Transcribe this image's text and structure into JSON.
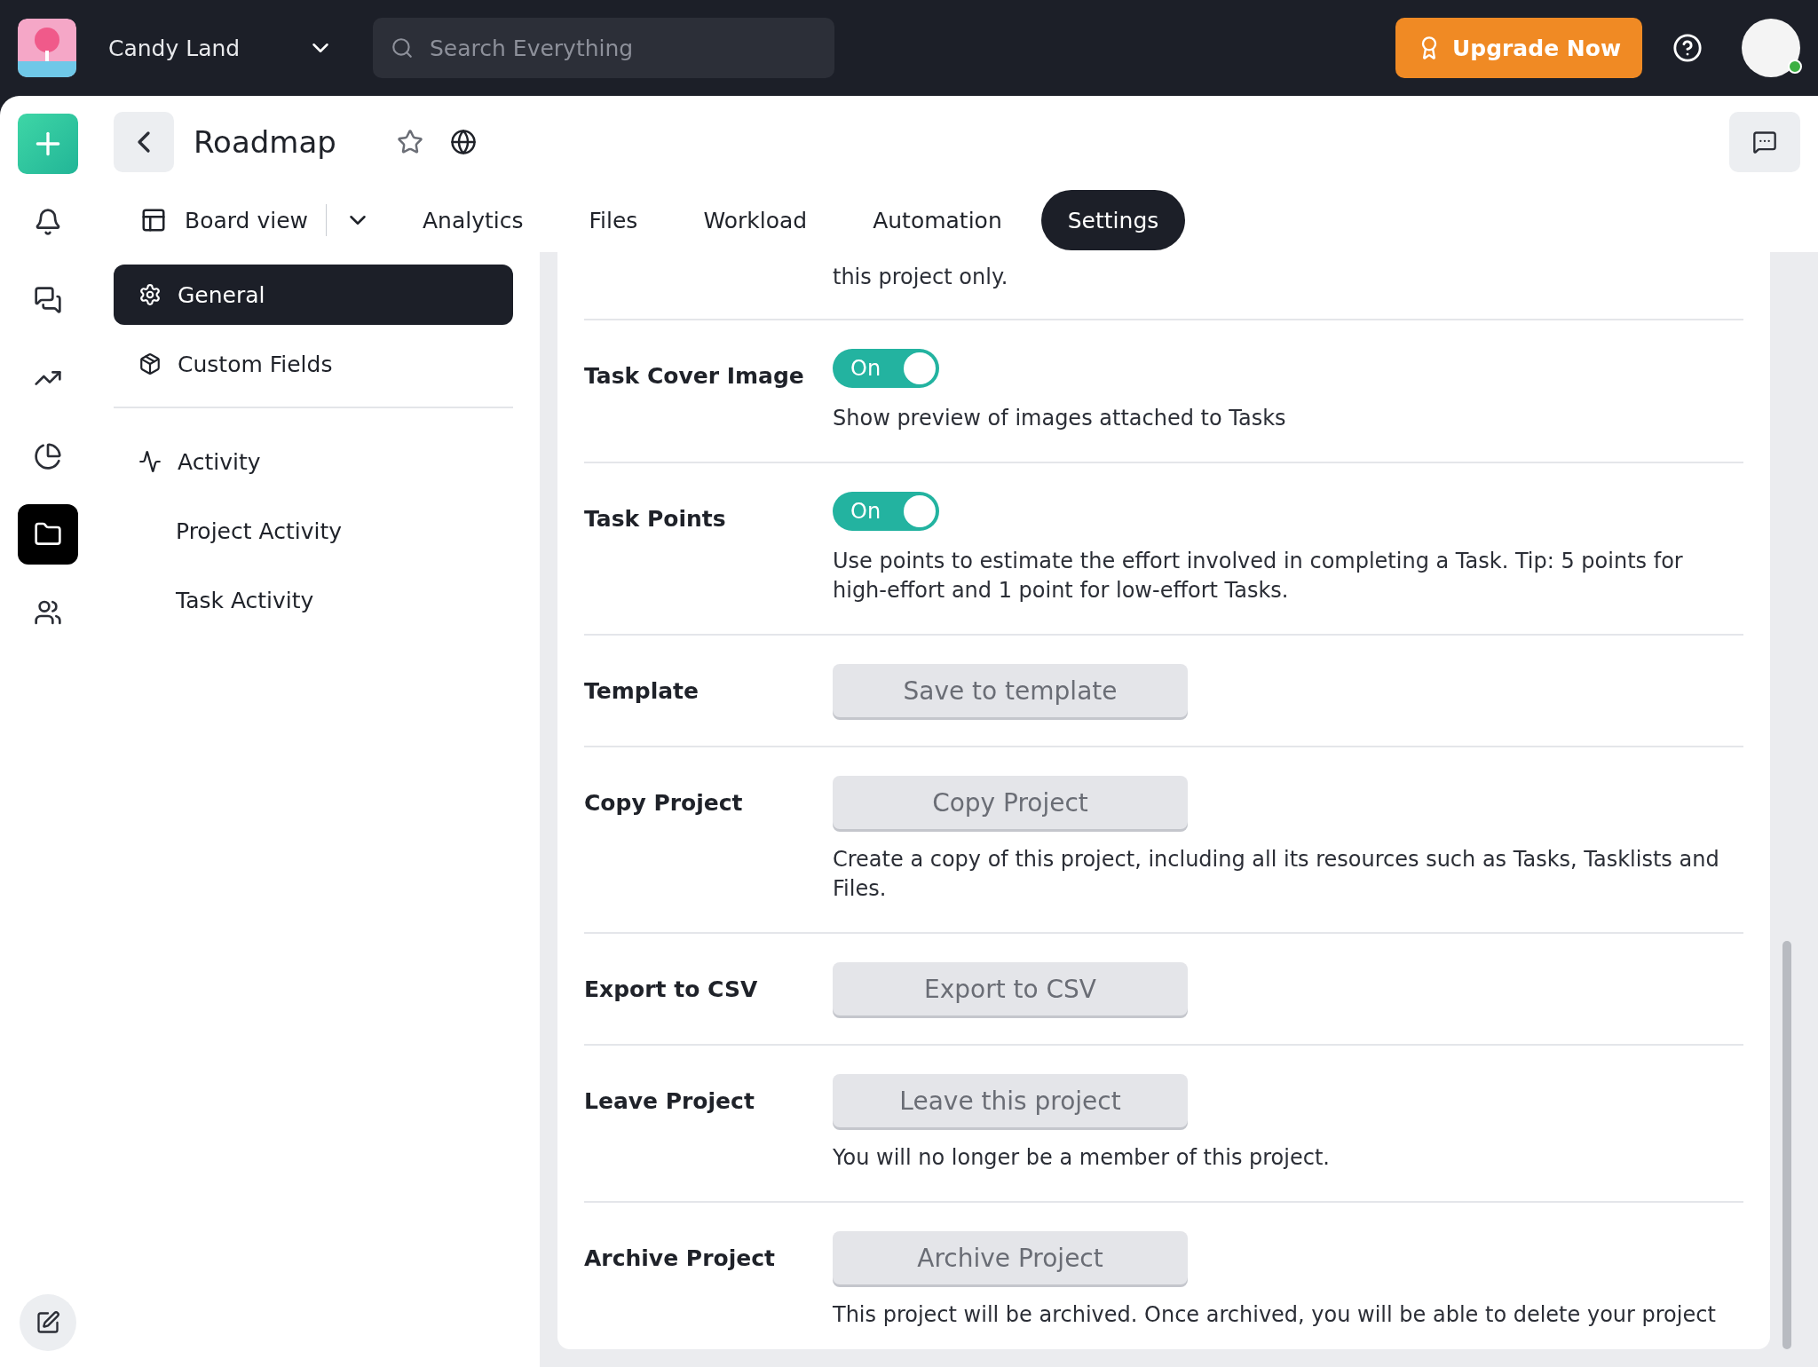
{
  "workspace": {
    "name": "Candy Land"
  },
  "search": {
    "placeholder": "Search Everything"
  },
  "upgrade_button": {
    "label": "Upgrade Now"
  },
  "user": {
    "online": true
  },
  "rail": [
    {
      "selected": false
    },
    {
      "selected": false
    },
    {
      "selected": false
    },
    {
      "selected": false
    },
    {
      "selected": true
    },
    {
      "selected": false
    }
  ],
  "project": {
    "title": "Roadmap",
    "starred": false
  },
  "tabs": [
    {
      "label": "Board view",
      "kind": "view",
      "selected": false
    },
    {
      "label": "Analytics",
      "kind": "tab",
      "selected": false
    },
    {
      "label": "Files",
      "kind": "tab",
      "selected": false
    },
    {
      "label": "Workload",
      "kind": "tab",
      "selected": false
    },
    {
      "label": "Automation",
      "kind": "tab",
      "selected": false
    },
    {
      "label": "Settings",
      "kind": "tab",
      "selected": true
    }
  ],
  "settings_nav": {
    "sections": [
      {
        "label": "General",
        "selected": true
      },
      {
        "label": "Custom Fields",
        "selected": false
      }
    ],
    "activity": {
      "label": "Activity",
      "children": [
        {
          "label": "Project Activity",
          "selected": false
        },
        {
          "label": "Task Activity",
          "selected": false
        }
      ]
    }
  },
  "settings": [
    {
      "kind": "note",
      "description": "this project only."
    },
    {
      "kind": "toggle",
      "label": "Task Cover Image",
      "on": true,
      "state_label": "On",
      "description": "Show preview of images attached to Tasks"
    },
    {
      "kind": "toggle",
      "label": "Task Points",
      "on": true,
      "state_label": "On",
      "description": "Use points to estimate the effort involved in completing a Task. Tip: 5 points for high-effort and 1 point for low-effort Tasks."
    },
    {
      "kind": "button",
      "label": "Template",
      "button": "Save to template"
    },
    {
      "kind": "button",
      "label": "Copy Project",
      "button": "Copy Project",
      "description": "Create a copy of this project, including all its resources such as Tasks, Tasklists and Files."
    },
    {
      "kind": "button",
      "label": "Export to CSV",
      "button": "Export to CSV"
    },
    {
      "kind": "button",
      "label": "Leave Project",
      "button": "Leave this project",
      "description": "You will no longer be a member of this project."
    },
    {
      "kind": "button",
      "label": "Archive Project",
      "button": "Archive Project",
      "description": "This project will be archived. Once archived, you will be able to delete your project"
    }
  ]
}
